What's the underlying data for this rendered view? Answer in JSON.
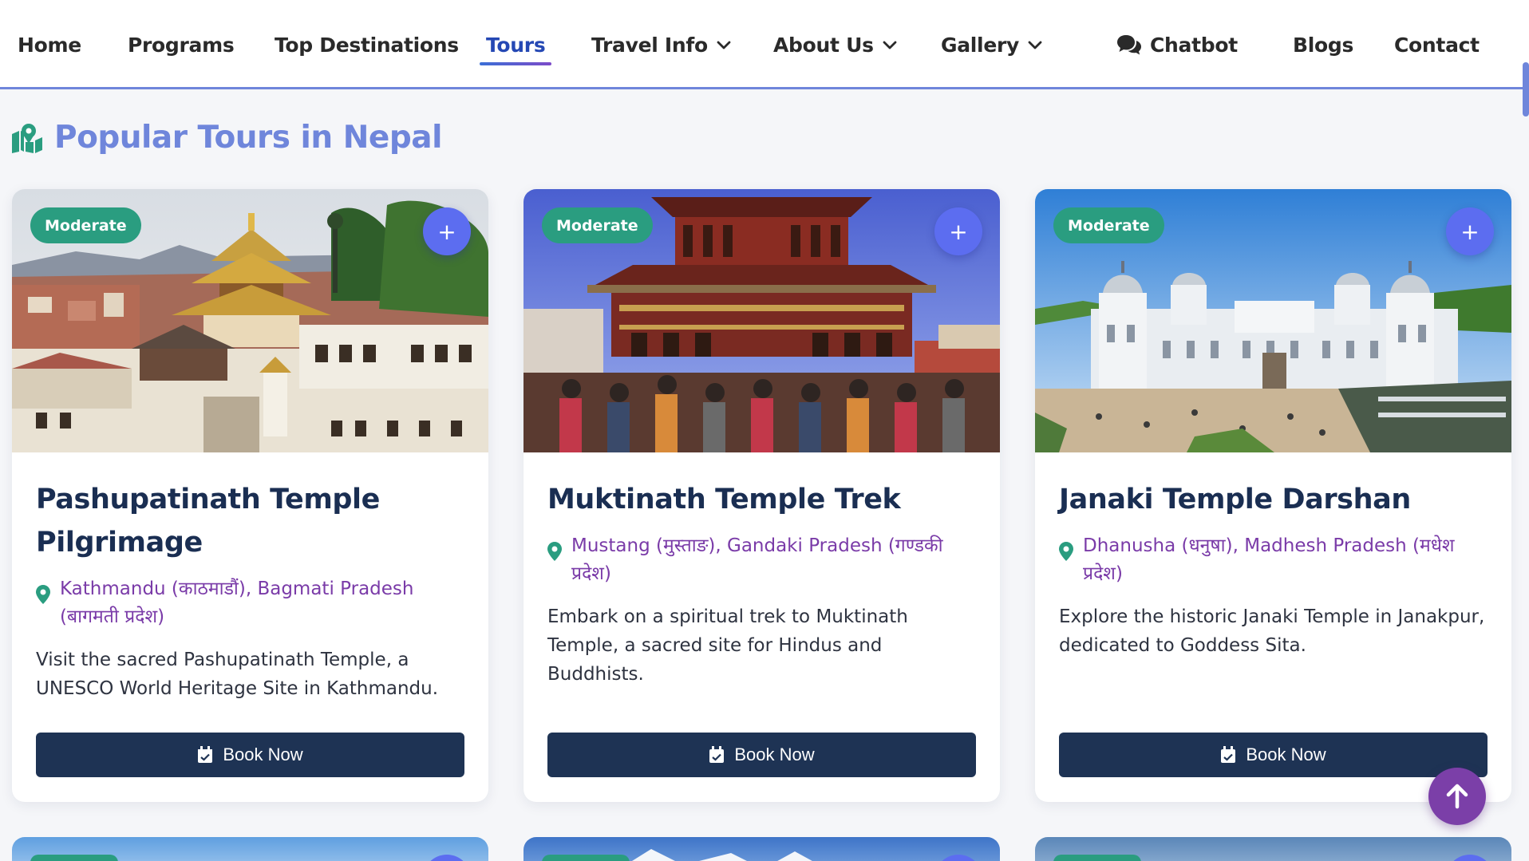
{
  "nav": {
    "items": [
      {
        "label": "Home",
        "dropdown": false
      },
      {
        "label": "Programs",
        "dropdown": false
      },
      {
        "label": "Top Destinations",
        "dropdown": false
      },
      {
        "label": "Tours",
        "dropdown": false,
        "active": true
      },
      {
        "label": "Travel Info",
        "dropdown": true
      },
      {
        "label": "About Us",
        "dropdown": true
      },
      {
        "label": "Gallery",
        "dropdown": true
      },
      {
        "label": "Chatbot",
        "dropdown": false,
        "icon": "chat-icon"
      },
      {
        "label": "Blogs",
        "dropdown": false
      },
      {
        "label": "Contact",
        "dropdown": false
      }
    ]
  },
  "page": {
    "heading": "Popular Tours in Nepal",
    "heading_icon": "map-marker-icon"
  },
  "tours": [
    {
      "badge": "Moderate",
      "plus": "+",
      "title": "Pashupatinath Temple Pilgrimage",
      "location": "Kathmandu (काठमाडौं), Bagmati Pradesh (बागमती प्रदेश)",
      "description": "Visit the sacred Pashupatinath Temple, a UNESCO World Heritage Site in Kathmandu.",
      "button": "Book Now"
    },
    {
      "badge": "Moderate",
      "plus": "+",
      "title": "Muktinath Temple Trek",
      "location": "Mustang (मुस्ताङ), Gandaki Pradesh (गण्डकी प्रदेश)",
      "description": "Embark on a spiritual trek to Muktinath Temple, a sacred site for Hindus and Buddhists.",
      "button": "Book Now"
    },
    {
      "badge": "Moderate",
      "plus": "+",
      "title": "Janaki Temple Darshan",
      "location": "Dhanusha (धनुषा), Madhesh Pradesh (मधेश प्रदेश)",
      "description": "Explore the historic Janaki Temple in Janakpur, dedicated to Goddess Sita.",
      "button": "Book Now"
    }
  ],
  "colors": {
    "accent": "#6f86db",
    "active_nav": "#2548b4",
    "badge": "#2a9d80",
    "plus_button": "#5c6df0",
    "book_button": "#1e3354",
    "location_text": "#7a3ba8",
    "scroll_top": "#7b3fa8"
  }
}
